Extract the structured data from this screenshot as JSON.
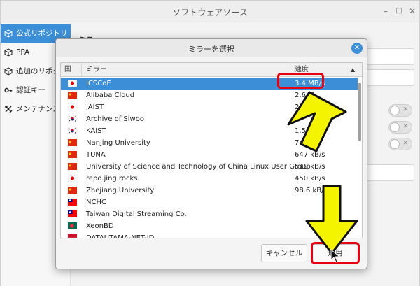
{
  "window": {
    "title": "ソフトウェアソース",
    "min_glyph": "–",
    "max_glyph": "□",
    "close_glyph": "✕"
  },
  "sidebar": {
    "items": [
      {
        "label": "公式リポジトリ",
        "icon": "package-icon",
        "active": true
      },
      {
        "label": "PPA",
        "icon": "package-icon",
        "active": false
      },
      {
        "label": "追加のリポジトリ",
        "icon": "package-icon",
        "active": false
      },
      {
        "label": "認証キー",
        "icon": "key-icon",
        "active": false
      },
      {
        "label": "メンテナンス",
        "icon": "tools-icon",
        "active": false
      }
    ]
  },
  "background": {
    "section_label": "ミラ"
  },
  "dialog": {
    "title": "ミラーを選択",
    "close_glyph": "✕",
    "columns": {
      "country": "国",
      "mirror": "ミラー",
      "speed": "速度"
    },
    "sort_glyph": "▲",
    "rows": [
      {
        "flag": "jp",
        "name": "ICSCoE",
        "speed": "3.4 MB/s",
        "selected": true
      },
      {
        "flag": "cn",
        "name": "Alibaba Cloud",
        "speed": "2.6 M",
        "selected": false
      },
      {
        "flag": "jp",
        "name": "JAIST",
        "speed": "2.3",
        "selected": false
      },
      {
        "flag": "kr",
        "name": "Archive of Siwoo",
        "speed": "",
        "selected": false
      },
      {
        "flag": "kr",
        "name": "KAIST",
        "speed": "1.5 M",
        "selected": false
      },
      {
        "flag": "cn",
        "name": "Nanjing University",
        "speed": "746 kB",
        "selected": false
      },
      {
        "flag": "cn",
        "name": "TUNA",
        "speed": "647 kB/s",
        "selected": false
      },
      {
        "flag": "cn",
        "name": "University of Science and Technology of China Linux User Group",
        "speed": "519 kB/s",
        "selected": false
      },
      {
        "flag": "jp",
        "name": "repo.jing.rocks",
        "speed": "450 kB/s",
        "selected": false
      },
      {
        "flag": "cn",
        "name": "Zhejiang University",
        "speed": "98.6 kB/s",
        "selected": false
      },
      {
        "flag": "tw",
        "name": "NCHC",
        "speed": "",
        "selected": false
      },
      {
        "flag": "tw",
        "name": "Taiwan Digital Streaming Co.",
        "speed": "",
        "selected": false
      },
      {
        "flag": "bd",
        "name": "XeonBD",
        "speed": "",
        "selected": false
      },
      {
        "flag": "id",
        "name": "DATAUTAMA-NET-ID",
        "speed": "",
        "selected": false
      }
    ],
    "cancel_label": "キャンセル",
    "apply_label": "適用"
  },
  "colors": {
    "accent": "#3c8fd6",
    "annotation_red": "#e60012",
    "annotation_arrow": "#f4f400"
  }
}
